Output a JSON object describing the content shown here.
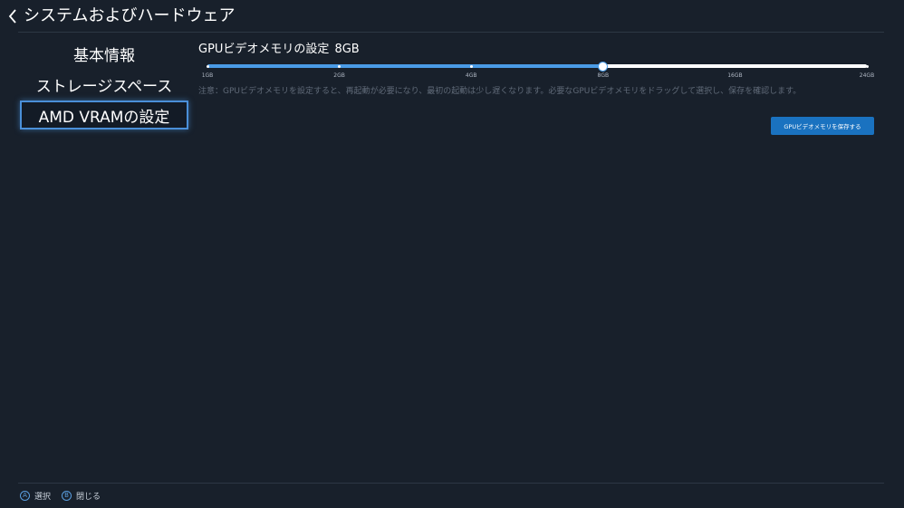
{
  "header": {
    "title": "システムおよびハードウェア",
    "back_icon": "chevron-left-icon"
  },
  "sidebar": {
    "items": [
      {
        "label": "基本情報",
        "selected": false
      },
      {
        "label": "ストレージスペース",
        "selected": false
      },
      {
        "label": "AMD VRAMの設定",
        "selected": true
      }
    ]
  },
  "vram": {
    "title": "GPUビデオメモリの設定",
    "current_value": "8GB",
    "slider": {
      "options": [
        "1GB",
        "2GB",
        "4GB",
        "8GB",
        "16GB",
        "24GB"
      ],
      "selected_index": 3
    },
    "note": "注意：GPUビデオメモリを設定すると、再起動が必要になり、最初の起動は少し遅くなります。必要なGPUビデオメモリをドラッグして選択し、保存を確認します。",
    "save_label": "GPUビデオメモリを保存する"
  },
  "footer": {
    "hints": [
      {
        "key": "A",
        "label": "選択"
      },
      {
        "key": "B",
        "label": "閉じる"
      }
    ]
  },
  "colors": {
    "background": "#18202b",
    "accent": "#4a9be6",
    "button": "#1a72c0",
    "divider": "#2d3744"
  }
}
